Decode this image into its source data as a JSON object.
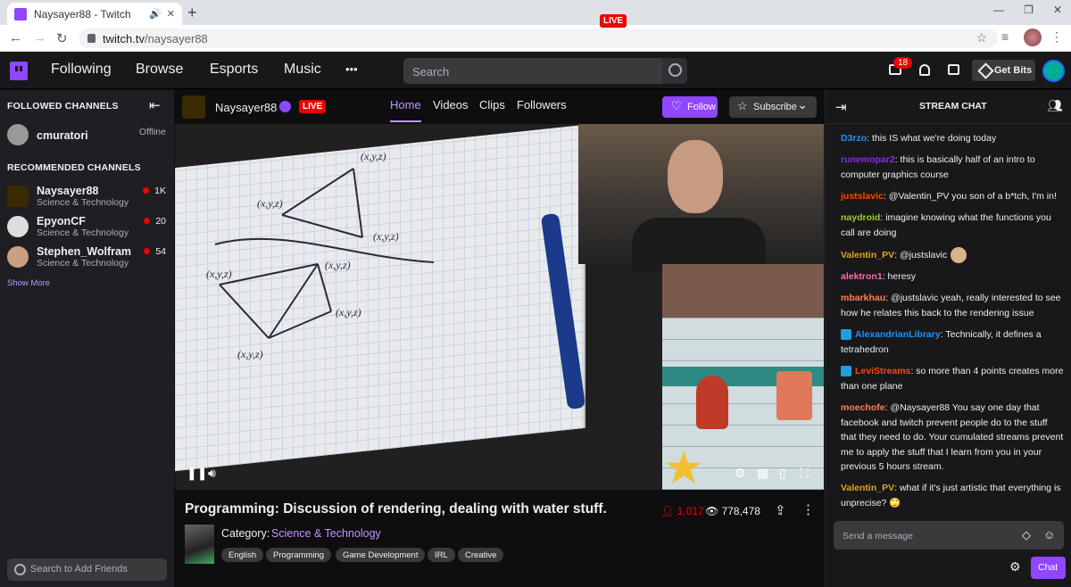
{
  "browser": {
    "tab_title": "Naysayer88 - Twitch",
    "url_domain": "twitch.tv",
    "url_path": "/naysayer88"
  },
  "topnav": {
    "links": [
      "Following",
      "Browse",
      "Esports",
      "Music"
    ],
    "more": "•••",
    "search_placeholder": "Search",
    "inbox_count": "18",
    "get_bits": "Get Bits"
  },
  "sidebar": {
    "followed_header": "FOLLOWED CHANNELS",
    "followed": [
      {
        "name": "cmuratori",
        "status": "Offline"
      }
    ],
    "recommended_header": "RECOMMENDED CHANNELS",
    "recommended": [
      {
        "name": "Naysayer88",
        "category": "Science & Technology",
        "viewers": "1K"
      },
      {
        "name": "EpyonCF",
        "category": "Science & Technology",
        "viewers": "20"
      },
      {
        "name": "Stephen_Wolfram",
        "category": "Science & Technology",
        "viewers": "54"
      }
    ],
    "show_more": "Show More",
    "friend_search_placeholder": "Search to Add Friends"
  },
  "channel": {
    "name": "Naysayer88",
    "live_label": "LIVE",
    "tabs": [
      "Home",
      "Videos",
      "Clips",
      "Followers"
    ],
    "follow_label": "Follow",
    "subscribe_label": "Subscribe"
  },
  "video": {
    "cam_live_label": "LIVE",
    "sketch_labels": [
      "(x,y,z)",
      "(x,y,z)",
      "(x,y,z)",
      "(x,y,z)",
      "(x,y,z)",
      "(x,y,z)",
      "(x,y,z)",
      "(x,y,z)"
    ]
  },
  "stream": {
    "title": "Programming: Discussion of rendering, dealing with water stuff.",
    "viewers": "1,017",
    "total_views": "778,478",
    "category_label": "Category:",
    "category": "Science & Technology",
    "tags": [
      "English",
      "Programming",
      "Game Development",
      "IRL",
      "Creative"
    ]
  },
  "chat": {
    "title": "STREAM CHAT",
    "messages": [
      {
        "user": "D3rzo",
        "color": "#1e90ff",
        "text": "this IS what we're doing today"
      },
      {
        "user": "runemopar2",
        "color": "#8a2be2",
        "text": "this is basically half of an intro to computer graphics course"
      },
      {
        "user": "justslavic",
        "color": "#ff4500",
        "text": "@Valentin_PV you son of a b*tch, I'm in!"
      },
      {
        "user": "naydroid",
        "color": "#9acd32",
        "text": "imagine knowing what the functions you call are doing"
      },
      {
        "user": "Valentin_PV",
        "color": "#daa520",
        "text": "@justslavic"
      },
      {
        "user": "alektron1",
        "color": "#ff69b4",
        "text": "heresy"
      },
      {
        "user": "mbarkhau",
        "color": "#ff7f50",
        "text": "@justslavic yeah, really interested to see how he relates this back to the rendering issue"
      },
      {
        "user": "AlexandrianLibrary",
        "color": "#1e90ff",
        "text": "Technically, it defines a tetrahedron"
      },
      {
        "user": "LeviStreams",
        "color": "#ff4500",
        "text": "so more than 4 points creates more than one plane"
      },
      {
        "user": "moechofe",
        "color": "#ff7f50",
        "text": "@Naysayer88 You say one day that facebook and twitch prevent people do to the stuff that they need to do. Your cumulated streams prevent me to apply the stuff that I learn from you in your previous 5 hours stream."
      },
      {
        "user": "Valentin_PV",
        "color": "#daa520",
        "text": "what if it's just artistic that everything is unprecise? 🙄"
      }
    ],
    "input_placeholder": "Send a message",
    "send_label": "Chat"
  }
}
